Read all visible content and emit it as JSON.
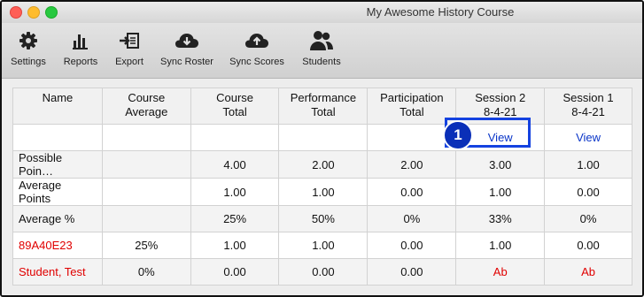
{
  "window": {
    "title": "My Awesome History Course"
  },
  "toolbar": {
    "items": [
      {
        "label": "Settings",
        "icon": "gear-icon"
      },
      {
        "label": "Reports",
        "icon": "bar-chart-icon"
      },
      {
        "label": "Export",
        "icon": "export-icon"
      },
      {
        "label": "Sync Roster",
        "icon": "cloud-download-icon"
      },
      {
        "label": "Sync Scores",
        "icon": "cloud-upload-icon"
      },
      {
        "label": "Students",
        "icon": "students-icon"
      }
    ]
  },
  "table": {
    "headers": [
      {
        "line1": "Name",
        "line2": ""
      },
      {
        "line1": "Course",
        "line2": "Average"
      },
      {
        "line1": "Course",
        "line2": "Total"
      },
      {
        "line1": "Performance",
        "line2": "Total"
      },
      {
        "line1": "Participation",
        "line2": "Total"
      },
      {
        "line1": "Session 2",
        "line2": "8-4-21"
      },
      {
        "line1": "Session 1",
        "line2": "8-4-21"
      }
    ],
    "view_row": {
      "session2": "View",
      "session1": "View"
    },
    "rows": [
      {
        "name": "Possible Poin…",
        "course_avg": "",
        "course_total": "4.00",
        "performance": "2.00",
        "participation": "2.00",
        "session2": "3.00",
        "session1": "1.00"
      },
      {
        "name": "Average Points",
        "course_avg": "",
        "course_total": "1.00",
        "performance": "1.00",
        "participation": "0.00",
        "session2": "1.00",
        "session1": "0.00"
      },
      {
        "name": "Average %",
        "course_avg": "",
        "course_total": "25%",
        "performance": "50%",
        "participation": "0%",
        "session2": "33%",
        "session1": "0%"
      },
      {
        "name": "89A40E23",
        "course_avg": "25%",
        "course_total": "1.00",
        "performance": "1.00",
        "participation": "0.00",
        "session2": "1.00",
        "session1": "0.00"
      },
      {
        "name": "Student, Test",
        "course_avg": "0%",
        "course_total": "0.00",
        "performance": "0.00",
        "participation": "0.00",
        "session2": "Ab",
        "session1": "Ab"
      }
    ]
  },
  "callout": {
    "number": "1"
  },
  "colors": {
    "accent": "#1442e0",
    "student_text": "#e00000",
    "link": "#0a35c8"
  }
}
